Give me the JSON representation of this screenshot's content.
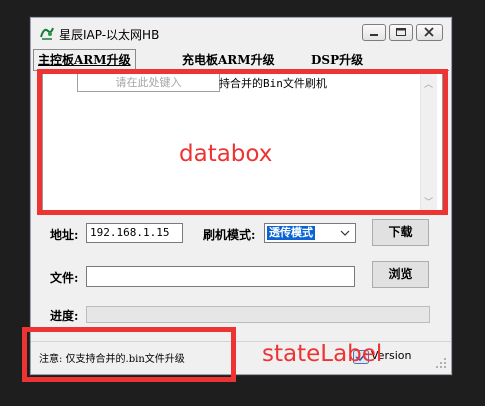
{
  "window": {
    "title": "星辰IAP-以太网HB",
    "minimize_label": "minimize",
    "maximize_label": "maximize",
    "close_label": "close"
  },
  "tabs": [
    {
      "label": "主控板ARM升级",
      "active": true
    },
    {
      "label": "充电板ARM升级",
      "active": false
    },
    {
      "label": "DSP升级",
      "active": false
    }
  ],
  "databox": {
    "input_placeholder": "请在此处键入",
    "text": "持合并的Bin文件刷机"
  },
  "annotations": {
    "databox_label": "databox",
    "statelabel_label": "stateLabel",
    "color": "#ee3333"
  },
  "form": {
    "address_label": "地址:",
    "address_value": "192.168.1.15",
    "mode_label": "刷机模式:",
    "mode_value": "透传模式",
    "download_button": "下载",
    "file_label": "文件:",
    "file_value": "",
    "browse_button": "浏览",
    "progress_label": "进度:",
    "progress_value": 0
  },
  "status": {
    "state_text": "注意: 仅支持合并的.bin文件升级",
    "version_text": "Version"
  },
  "colors": {
    "selection": "#0a64d6",
    "window_bg": "#f0f0f0"
  }
}
